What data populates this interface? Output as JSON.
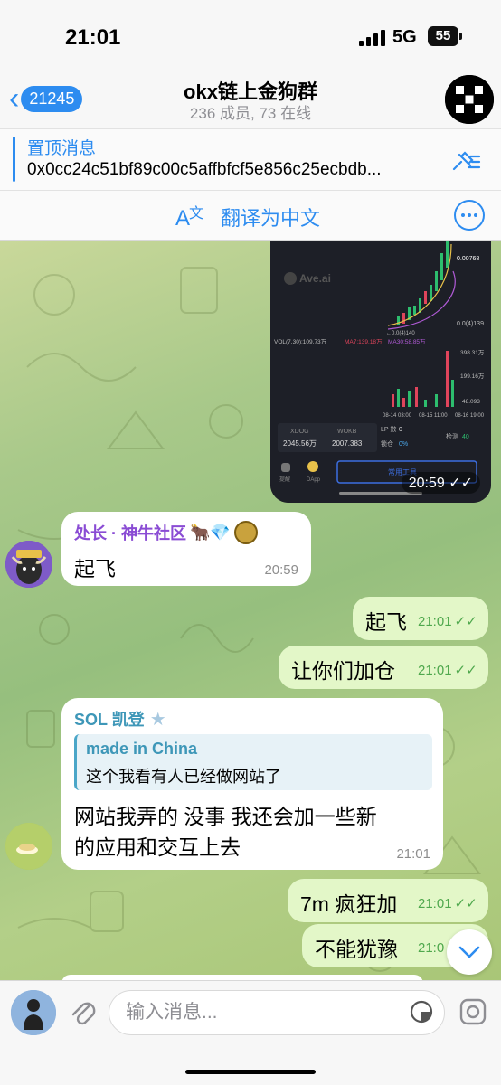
{
  "status": {
    "time": "21:01",
    "network": "5G",
    "battery": "55"
  },
  "header": {
    "back_count": "21245",
    "title": "okx链上金狗群",
    "subtitle": "236 成员, 73 在线"
  },
  "pinned": {
    "label": "置顶消息",
    "text": "0x0cc24c51bf89c00c5affbfcf5e856c25ecbdb..."
  },
  "translate": {
    "label": "翻译为中文"
  },
  "chart_screenshot": {
    "brand": "Ave.ai",
    "price_label": "0.00768",
    "price_label2": "0.0(4)139",
    "price_marker": "←0.0(4)140",
    "vol_text": "VOL(7,30):109.73万",
    "ma7_text": "MA7:139.18万",
    "ma30_text": "MA30:58.85万",
    "vol_ticks": [
      "398.31万",
      "199.16万",
      "48.093"
    ],
    "dates": [
      "08-14 03:00",
      "08-15 11:00",
      "08-16 19:00"
    ],
    "pair_left_name": "XDOG",
    "pair_left_value": "2045.56万",
    "pair_right_name": "WOKB",
    "pair_right_value": "2007.383",
    "lp_label": "LP 數",
    "lp_value": "0",
    "lock_label": "锁仓",
    "lock_value": "0%",
    "check_label": "检测",
    "check_value": "40",
    "tab1": "提醒",
    "tab2": "DApp",
    "tool_button": "常用工具",
    "time": "20:59"
  },
  "messages": [
    {
      "sender": "处长 · 神牛社区",
      "sender_emoji": "🐂💎",
      "text": "起飞",
      "time": "20:59"
    },
    {
      "text": "起飞",
      "time": "21:01"
    },
    {
      "text": "让你们加仓",
      "time": "21:01"
    },
    {
      "sender": "SOL 凯登",
      "reply_name": "made in China",
      "reply_text": "这个我看有人已经做网站了",
      "text_line1": "网站我弄的 没事 我还会加一些新",
      "text_line2": "的应用和交互上去",
      "time": "21:01"
    },
    {
      "text": "7m 疯狂加",
      "time": "21:01"
    },
    {
      "text": "不能犹豫",
      "time": "21:0"
    }
  ],
  "input": {
    "placeholder": "输入消息..."
  },
  "colors": {
    "accent": "#2d8cf0",
    "incoming_name_1": "#8a4cd4",
    "incoming_name_2": "#3e97b8",
    "outgoing_bg": "#e3f7c8"
  }
}
